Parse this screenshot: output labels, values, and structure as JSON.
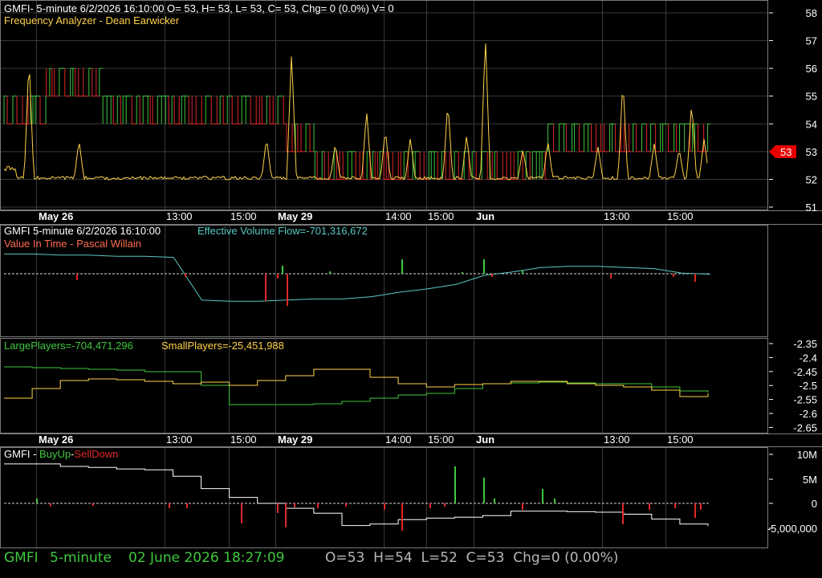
{
  "colors": {
    "background": "#000000",
    "grid": "#3a3a3a",
    "frame": "#7a7a7a",
    "white": "#ffffff",
    "yellow": "#ffd24a",
    "green": "#3ec83e",
    "red": "#e02828",
    "cyan": "#58c8c0",
    "salmon": "#ff6a50",
    "badge": "#e80000"
  },
  "panel1": {
    "line1": "GMFI- 5-minute 6/2/2026 16:10:00 O= 53, H= 53, L= 53, C= 53, Chg= 0 (0.0%) V= 0",
    "line2": "Frequency Analyzer - Dean Earwicker",
    "last_price_badge": "53"
  },
  "panel2": {
    "line1_a": "GMFI 5-minute  6/2/2026 16:10:00",
    "line1_b": "Effective Volume Flow=-701,316,672",
    "line2": "Value In Time - Pascal Willain"
  },
  "panel3": {
    "large": "LargePlayers=-704,471,296",
    "small": "SmallPlayers=-25,451,988"
  },
  "panel4": {
    "prefix": "GMFI - ",
    "buy": "BuyUp",
    "sep": "-",
    "sell": "SellDown"
  },
  "date_axis": [
    "May 26",
    "13:00",
    "15:00",
    "May 29",
    "14:00",
    "15:00",
    "Jun",
    "13:00",
    "15:00"
  ],
  "date_axis_bold": [
    true,
    false,
    false,
    true,
    false,
    false,
    true,
    false,
    false
  ],
  "status": {
    "symbol": "GMFI",
    "interval": "5-minute",
    "datetime": "02 June 2026 18:27:09",
    "ohlc": "O=53  H=54  L=52  C=53  Chg=0 (0.00%)"
  },
  "chart_data": [
    {
      "type": "line",
      "title": "Frequency Analyzer - Dean Earwicker",
      "ylim": [
        50.5,
        58.5
      ],
      "yticks": [
        "58",
        "57",
        "56",
        "55",
        "54",
        "53",
        "52",
        "51"
      ],
      "last": 53,
      "segments": [
        {
          "from": 0,
          "to": 0.06,
          "low": 54,
          "high": 55
        },
        {
          "from": 0.06,
          "to": 0.14,
          "low": 55,
          "high": 56
        },
        {
          "from": 0.14,
          "to": 0.4,
          "low": 54,
          "high": 55
        },
        {
          "from": 0.4,
          "to": 0.44,
          "low": 53,
          "high": 54
        },
        {
          "from": 0.44,
          "to": 0.77,
          "low": 52,
          "high": 53
        },
        {
          "from": 0.77,
          "to": 1,
          "low": 53,
          "high": 54
        }
      ],
      "spikes": [
        [
          0.04,
          56.4
        ],
        [
          0.12,
          53.4
        ],
        [
          0.42,
          53.5
        ],
        [
          0.46,
          56.6
        ],
        [
          0.53,
          53.3
        ],
        [
          0.58,
          54.5
        ],
        [
          0.61,
          53.8
        ],
        [
          0.65,
          53.5
        ],
        [
          0.71,
          54.8
        ],
        [
          0.74,
          53.6
        ],
        [
          0.77,
          57.2
        ],
        [
          0.83,
          53.1
        ],
        [
          0.87,
          53.4
        ],
        [
          0.95,
          53.2
        ],
        [
          0.99,
          55.6
        ],
        [
          1.04,
          53.3
        ],
        [
          1.08,
          53.1
        ],
        [
          1.1,
          54.8
        ],
        [
          1.12,
          53.5
        ]
      ],
      "baseline": 52.05
    },
    {
      "type": "line",
      "title": "Effective Volume Flow",
      "series": [
        {
          "name": "Effective Volume Flow",
          "values": [
            0.74,
            0.74,
            0.73,
            0.73,
            0.72,
            0.72,
            0.71,
            0.33,
            0.32,
            0.32,
            0.33,
            0.34,
            0.34,
            0.36,
            0.4,
            0.43,
            0.47,
            0.55,
            0.58,
            0.62,
            0.63,
            0.63,
            0.62,
            0.61,
            0.57,
            0.56
          ]
        }
      ]
    },
    {
      "type": "line",
      "yticks": [
        "-2.35",
        "-2.4",
        "-2.45",
        "-2.5",
        "-2.55",
        "-2.6",
        "-2.65"
      ],
      "series": [
        {
          "name": "LargePlayers",
          "values": [
            0.73,
            0.72,
            0.71,
            0.7,
            0.69,
            0.67,
            0.67,
            0.5,
            0.26,
            0.26,
            0.26,
            0.27,
            0.3,
            0.34,
            0.38,
            0.4,
            0.46,
            0.52,
            0.53,
            0.54,
            0.53,
            0.52,
            0.52,
            0.48,
            0.43,
            0.41
          ]
        },
        {
          "name": "SmallPlayers",
          "values": [
            0.34,
            0.46,
            0.56,
            0.58,
            0.57,
            0.55,
            0.52,
            0.54,
            0.5,
            0.56,
            0.62,
            0.7,
            0.7,
            0.6,
            0.52,
            0.48,
            0.51,
            0.52,
            0.55,
            0.55,
            0.52,
            0.5,
            0.48,
            0.44,
            0.36,
            0.4
          ]
        }
      ]
    },
    {
      "type": "bar",
      "title": "GMFI - BuyUp-SellDown",
      "yticks": [
        "10M",
        "5M",
        "0",
        "-5,000,000"
      ],
      "series": [
        {
          "name": "BuyUp-SellDown",
          "values": [
            8000000,
            8000000,
            7500000,
            7300000,
            7000000,
            6800000,
            5500000,
            3000000,
            1200000,
            0,
            -1000000,
            -2000000,
            -4500000,
            -4200000,
            -3300000,
            -3000000,
            -2800000,
            -2500000,
            -1600000,
            -1600000,
            -1700000,
            -1800000,
            -2200000,
            -3200000,
            -4200000,
            -4600000
          ]
        }
      ]
    }
  ]
}
